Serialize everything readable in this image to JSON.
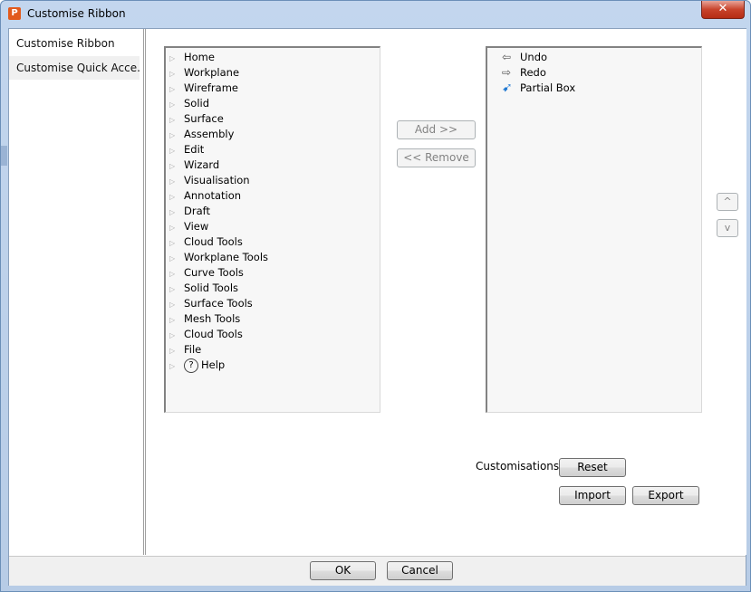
{
  "window": {
    "title": "Customise Ribbon",
    "close_glyph": "✕",
    "app_icon_letter": "P"
  },
  "sidebar": {
    "items": [
      {
        "label": "Customise Ribbon"
      },
      {
        "label": "Customise Quick Acce..."
      }
    ]
  },
  "ribbon_list": {
    "items": [
      {
        "label": "Home"
      },
      {
        "label": "Workplane"
      },
      {
        "label": "Wireframe"
      },
      {
        "label": "Solid"
      },
      {
        "label": "Surface"
      },
      {
        "label": "Assembly"
      },
      {
        "label": "Edit"
      },
      {
        "label": "Wizard"
      },
      {
        "label": "Visualisation"
      },
      {
        "label": "Annotation"
      },
      {
        "label": "Draft"
      },
      {
        "label": "View"
      },
      {
        "label": "Cloud Tools"
      },
      {
        "label": "Workplane Tools"
      },
      {
        "label": "Curve Tools"
      },
      {
        "label": "Solid Tools"
      },
      {
        "label": "Surface Tools"
      },
      {
        "label": "Mesh Tools"
      },
      {
        "label": "Cloud Tools"
      },
      {
        "label": "File"
      },
      {
        "label": "Help",
        "icon": "help-icon",
        "icon_glyph": "?"
      }
    ],
    "arrow_glyph": "▷"
  },
  "buttons": {
    "add": "Add >>",
    "remove": "<< Remove",
    "move_up": "^",
    "move_down": "v",
    "reset": "Reset",
    "import": "Import",
    "export": "Export",
    "ok": "OK",
    "cancel": "Cancel"
  },
  "quick_access": {
    "items": [
      {
        "label": "Undo",
        "icon": "undo-icon",
        "glyph": "⇦"
      },
      {
        "label": "Redo",
        "icon": "redo-icon",
        "glyph": "⇨"
      },
      {
        "label": "Partial Box",
        "icon": "partial-box-cursor-icon",
        "glyph": "➹"
      }
    ]
  },
  "customisations_label": "Customisations:",
  "colors": {
    "title_bar": "#c3d6ee",
    "close_button": "#c8432b",
    "app_icon": "#e25a1c",
    "cursor_icon": "#1f78d1"
  }
}
